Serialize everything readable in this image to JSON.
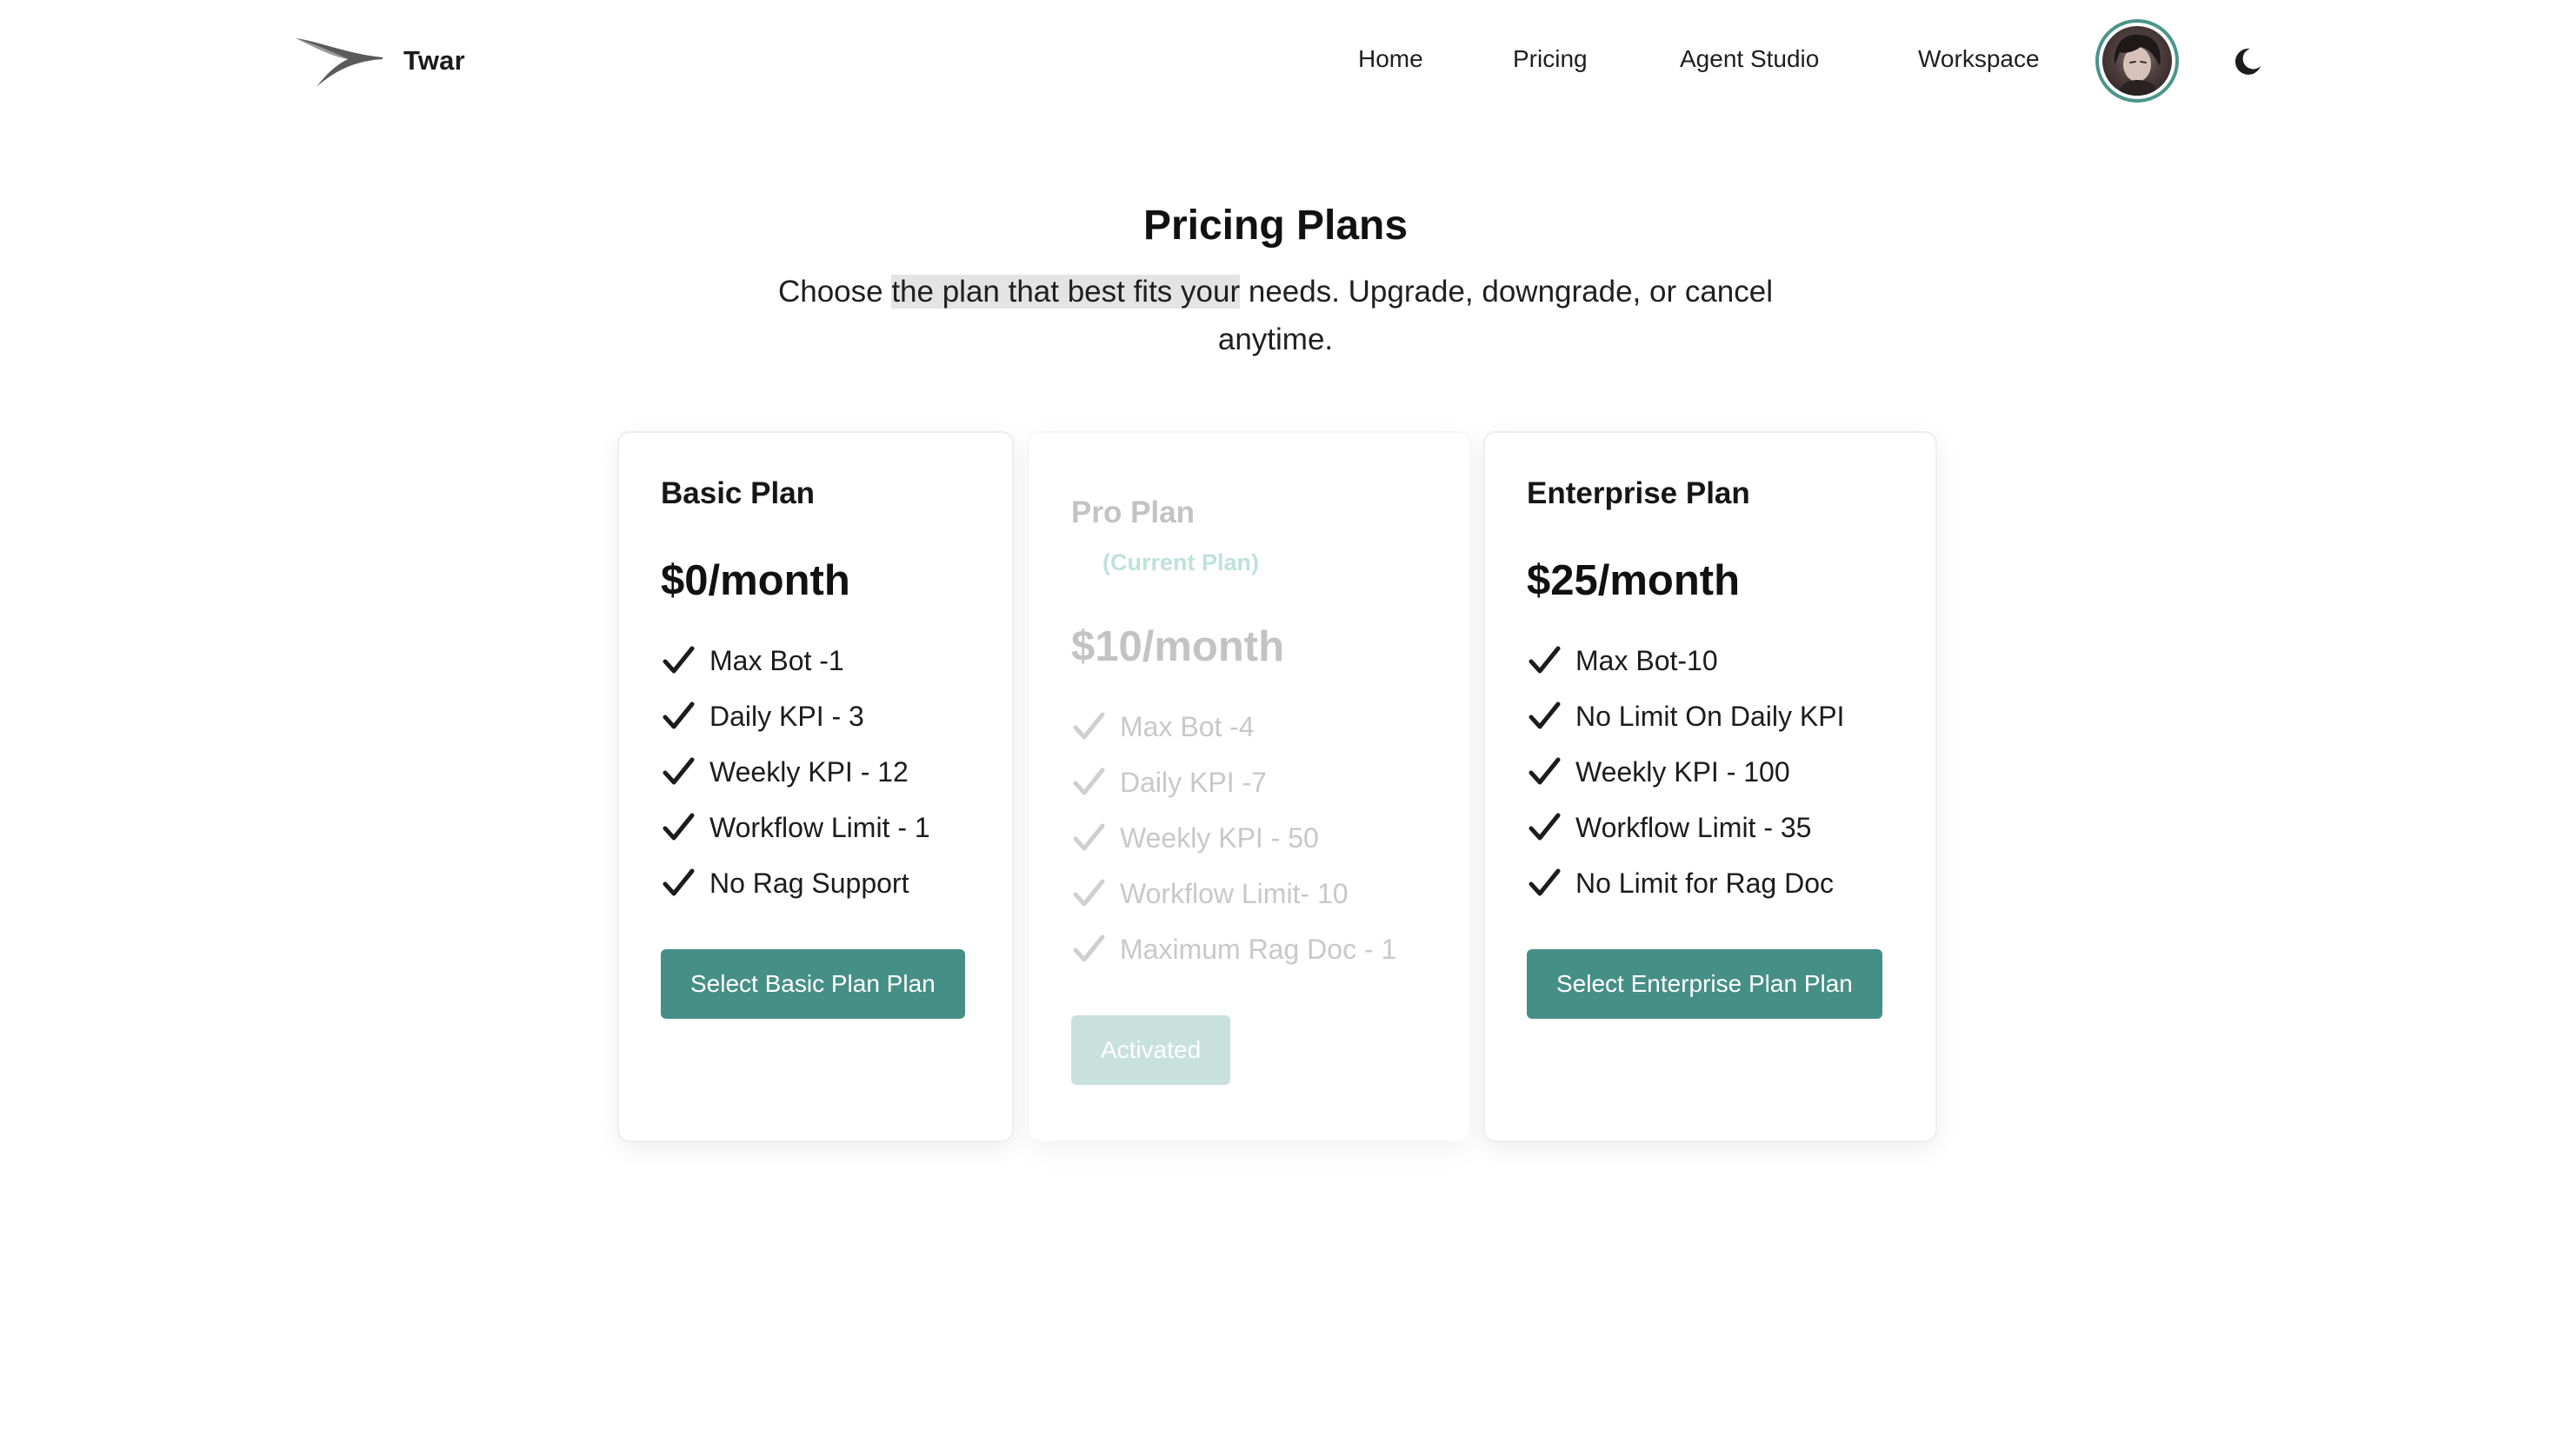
{
  "header": {
    "brand": "Twar",
    "nav": [
      {
        "label": "Home"
      },
      {
        "label": "Pricing"
      },
      {
        "label": "Agent Studio"
      },
      {
        "label": "Workspace"
      }
    ],
    "avatar_icon": "user-avatar",
    "theme_icon": "moon-icon"
  },
  "hero": {
    "title": "Pricing Plans",
    "subtitle_pre": "Choose ",
    "subtitle_highlight": "the plan that best fits your",
    "subtitle_post": " needs. Upgrade, downgrade, or cancel anytime."
  },
  "plans": [
    {
      "name": "Basic Plan",
      "price": "$0/month",
      "features": [
        "Max Bot -1",
        "Daily KPI - 3",
        "Weekly KPI - 12",
        "Workflow Limit - 1",
        "No Rag Support"
      ],
      "button": "Select Basic Plan Plan"
    },
    {
      "name": "Pro Plan",
      "tag": "(Current Plan)",
      "price": "$10/month",
      "features": [
        "Max Bot -4",
        "Daily KPI -7",
        "Weekly KPI - 50",
        "Workflow Limit- 10",
        "Maximum Rag Doc - 1"
      ],
      "button": "Activated"
    },
    {
      "name": "Enterprise Plan",
      "price": "$25/month",
      "features": [
        "Max Bot-10",
        "No Limit On Daily KPI",
        "Weekly KPI - 100",
        "Workflow Limit - 35",
        "No Limit for Rag Doc"
      ],
      "button": "Select Enterprise Plan Plan"
    }
  ],
  "colors": {
    "accent": "#468f86",
    "accent_disabled": "#c9e1dd",
    "avatar_ring": "#4b958a",
    "highlight": "#e4e4e4"
  },
  "icons": {
    "logo": "swoosh-logo-icon",
    "feature": "checkmark-icon"
  }
}
